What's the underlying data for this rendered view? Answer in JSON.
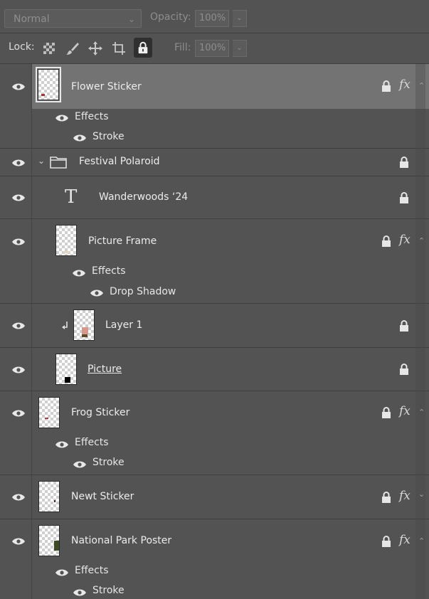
{
  "top": {
    "blend_mode": "Normal",
    "opacity_label": "Opacity:",
    "opacity_value": "100%",
    "lock_label": "Lock:",
    "fill_label": "Fill:",
    "fill_value": "100%"
  },
  "lock_icons": [
    "lock-transparent-pixels-icon",
    "lock-image-pixels-icon",
    "lock-position-icon",
    "lock-artboard-icon",
    "lock-all-icon"
  ],
  "layers": {
    "flower_sticker": {
      "name": "Flower Sticker",
      "fx": "fx",
      "effects_label": "Effects",
      "effect": "Stroke"
    },
    "festival_polaroid": {
      "name": "Festival Polaroid"
    },
    "wanderwoods": {
      "name": "Wanderwoods ‘24",
      "type_glyph": "T"
    },
    "picture_frame": {
      "name": "Picture Frame",
      "fx": "fx",
      "effects_label": "Effects",
      "effect": "Drop Shadow"
    },
    "layer1": {
      "name": "Layer 1"
    },
    "picture": {
      "name": "Picture "
    },
    "frog_sticker": {
      "name": "Frog Sticker",
      "fx": "fx",
      "effects_label": "Effects",
      "effect": "Stroke"
    },
    "newt_sticker": {
      "name": "Newt Sticker",
      "fx": "fx"
    },
    "national_park": {
      "name": "National Park Poster",
      "fx": "fx",
      "effects_label": "Effects",
      "effect": "Stroke"
    }
  },
  "colors": {
    "panel_bg": "#535353",
    "selected_row": "#737373",
    "text": "#ececec"
  }
}
